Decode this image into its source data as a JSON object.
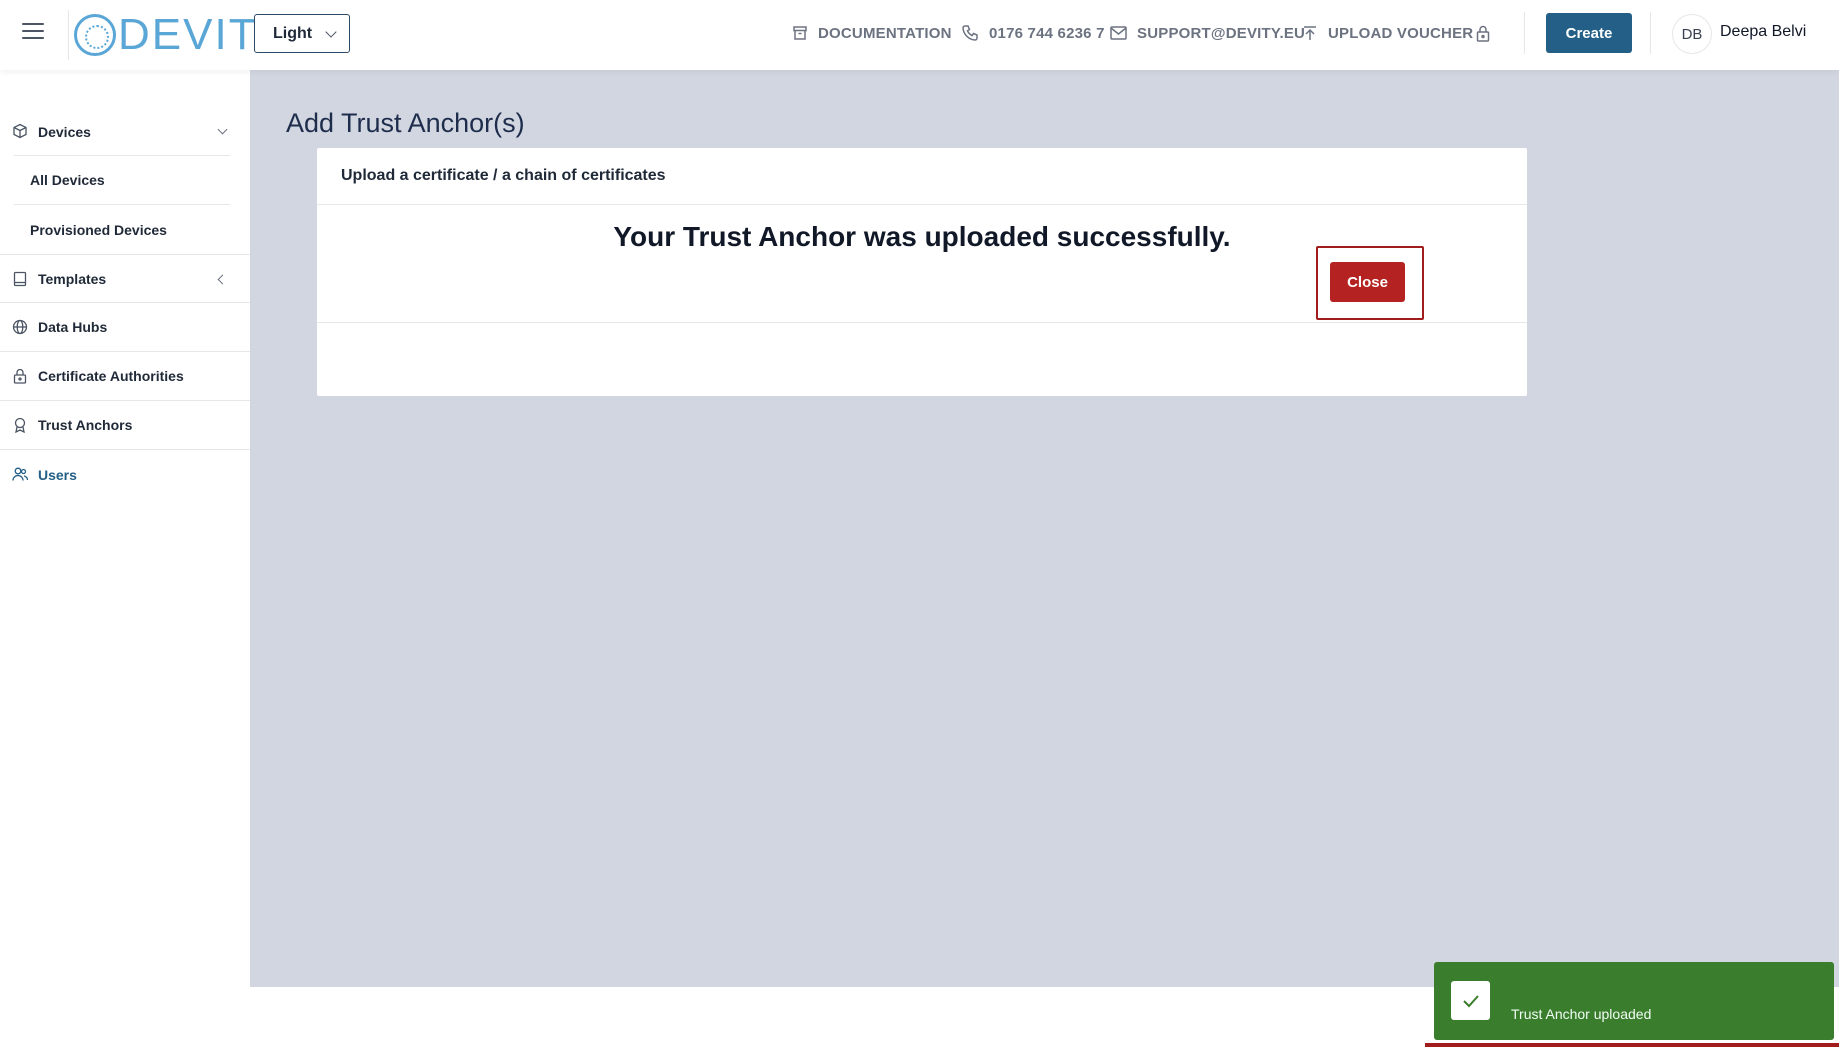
{
  "header": {
    "logo_text": "DEVITY",
    "theme_select": "Light",
    "links": {
      "documentation": "DOCUMENTATION",
      "phone": "0176 744 6236 7",
      "email": "SUPPORT@DEVITY.EU",
      "upload_voucher": "UPLOAD VOUCHER"
    },
    "create_label": "Create",
    "user_initials": "DB",
    "user_name": "Deepa Belvi"
  },
  "sidebar": {
    "devices": "Devices",
    "all_devices": "All Devices",
    "provisioned_devices": "Provisioned Devices",
    "templates": "Templates",
    "data_hubs": "Data Hubs",
    "certificate_authorities": "Certificate Authorities",
    "trust_anchors": "Trust Anchors",
    "users": "Users"
  },
  "main": {
    "page_title": "Add Trust Anchor(s)",
    "card_header": "Upload a certificate / a chain of certificates",
    "success_message": "Your Trust Anchor was uploaded successfully.",
    "close_label": "Close"
  },
  "toast": {
    "message": "Trust Anchor uploaded"
  },
  "colors": {
    "primary": "#235f86",
    "danger": "#b42222",
    "success": "#3a7d2c",
    "main_bg": "#d2d6e0",
    "logo": "#5aa6d6"
  }
}
